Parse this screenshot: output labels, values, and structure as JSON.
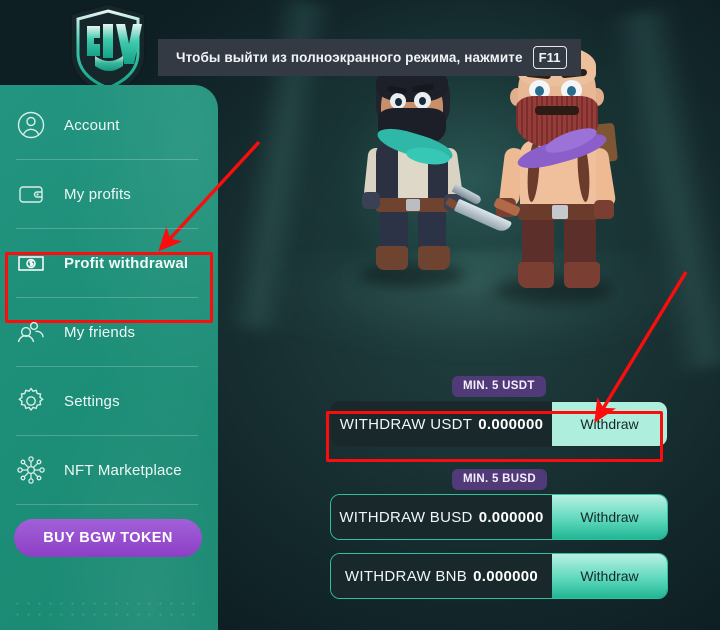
{
  "app": {
    "brand": "BGW",
    "logo_label": "bgw-shield-logo"
  },
  "notification": {
    "message": "Чтобы выйти из полноэкранного режима, нажмите",
    "key": "F11"
  },
  "sidebar": {
    "items": [
      {
        "label": "Account",
        "icon": "user-circle-icon",
        "active": false
      },
      {
        "label": "My profits",
        "icon": "wallet-icon",
        "active": false
      },
      {
        "label": "Profit withdrawal",
        "icon": "money-bill-icon",
        "active": true
      },
      {
        "label": "My friends",
        "icon": "users-icon",
        "active": false
      },
      {
        "label": "Settings",
        "icon": "gear-icon",
        "active": false
      },
      {
        "label": "NFT Marketplace",
        "icon": "nft-network-icon",
        "active": false
      }
    ],
    "token_button": "BUY BGW TOKEN"
  },
  "withdraw": {
    "rows": [
      {
        "badge": "MIN. 5 USDT",
        "label": "WITHDRAW USDT",
        "amount": "0.000000",
        "button": "Withdraw",
        "highlighted": true
      },
      {
        "badge": "MIN. 5 BUSD",
        "label": "WITHDRAW BUSD",
        "amount": "0.000000",
        "button": "Withdraw",
        "highlighted": false
      },
      {
        "badge": "",
        "label": "WITHDRAW BNB",
        "amount": "0.000000",
        "button": "Withdraw",
        "highlighted": false
      }
    ]
  },
  "annotations": {
    "arrow_to_sidebar": "red arrow pointing at Profit withdrawal menu item",
    "arrow_to_withdraw_button": "red arrow pointing at USDT Withdraw button",
    "highlight_color": "#fb0d0d"
  },
  "colors": {
    "sidebar_green": "#1e9077",
    "background_dark": "#142427",
    "accent_purple": "#8d3fc6",
    "badge_purple": "#513a78",
    "button_mint": "#aeeedd",
    "button_teal": "#21b694"
  }
}
